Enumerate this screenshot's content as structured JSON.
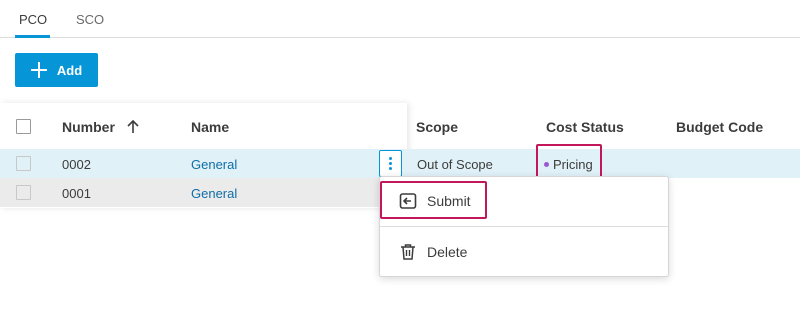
{
  "tabs": [
    {
      "label": "PCO",
      "active": true
    },
    {
      "label": "SCO",
      "active": false
    }
  ],
  "toolbar": {
    "add_label": "Add"
  },
  "table": {
    "columns": {
      "number": "Number",
      "name": "Name",
      "scope": "Scope",
      "cost_status": "Cost Status",
      "budget_code": "Budget Code"
    },
    "sort": {
      "column": "number",
      "direction": "ascending",
      "icon": "arrow-up-icon"
    },
    "rows": [
      {
        "number": "0002",
        "name": "General",
        "scope": "Out of Scope",
        "cost_status": "Pricing",
        "budget_code": "",
        "selected": true
      },
      {
        "number": "0001",
        "name": "General",
        "scope": "",
        "cost_status": "",
        "budget_code": "",
        "selected": false
      }
    ]
  },
  "row_menu": {
    "items": [
      {
        "label": "Submit",
        "icon": "submit-icon"
      },
      {
        "label": "Delete",
        "icon": "trash-icon"
      }
    ]
  },
  "colors": {
    "accent": "#0696d7",
    "highlight": "#c2185b",
    "link": "#0f6ea8",
    "selected_row": "#e1f1f8",
    "status_pricing": "#9b59d0"
  }
}
